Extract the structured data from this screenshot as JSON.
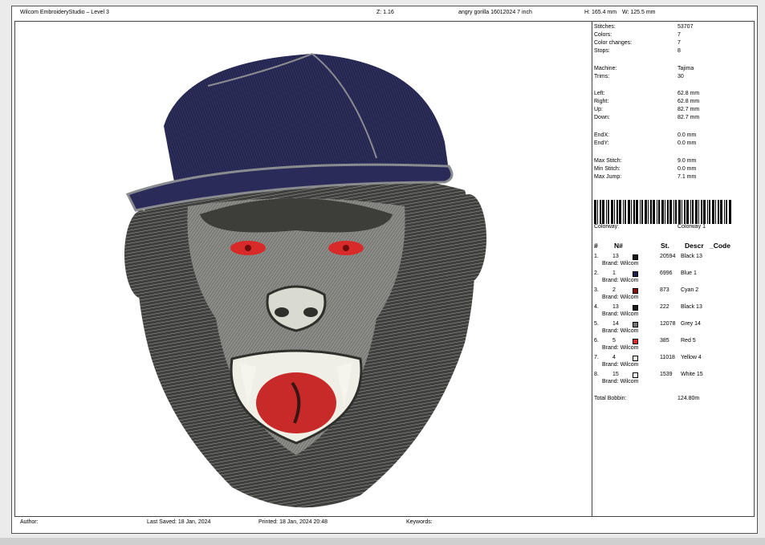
{
  "header": {
    "app_title": "Wilcom EmbroideryStudio – Level 3",
    "zoom": "Z: 1.16",
    "design_name": "angry gorilla 16012024 7 inch",
    "height": "H: 165.4 mm",
    "width": "W: 125.5 mm"
  },
  "stats": [
    {
      "label": "Stitches:",
      "value": "53707"
    },
    {
      "label": "Colors:",
      "value": "7"
    },
    {
      "label": "Color changes:",
      "value": "7"
    },
    {
      "label": "Stops:",
      "value": "8"
    },
    {
      "label": "Machine:",
      "value": "Tajima"
    },
    {
      "label": "Trims:",
      "value": "30"
    },
    {
      "label": "Left:",
      "value": "62.8 mm"
    },
    {
      "label": "Right:",
      "value": "62.8 mm"
    },
    {
      "label": "Up:",
      "value": "82.7 mm"
    },
    {
      "label": "Down:",
      "value": "82.7 mm"
    },
    {
      "label": "EndX:",
      "value": "0.0 mm"
    },
    {
      "label": "EndY:",
      "value": "0.0 mm"
    },
    {
      "label": "Max Stitch:",
      "value": "9.0 mm"
    },
    {
      "label": "Min Stitch:",
      "value": "0.0 mm"
    },
    {
      "label": "Max Jump:",
      "value": "7.1 mm"
    }
  ],
  "colorway": {
    "label": "Colorway:",
    "value": "Colorway 1"
  },
  "table": {
    "headers": {
      "index": "#",
      "needle": "N#",
      "stitches": "St.",
      "desc": "Descr",
      "code": "_Code"
    },
    "rows": [
      {
        "idx": "1.",
        "n": "13",
        "color": "#1a1a1a",
        "st": "20594",
        "desc": "Black 13",
        "brand": "Brand: Wilcom"
      },
      {
        "idx": "2.",
        "n": "1",
        "color": "#1e1f4a",
        "st": "6996",
        "desc": "Blue 1",
        "brand": "Brand: Wilcom"
      },
      {
        "idx": "3.",
        "n": "2",
        "color": "#8a1010",
        "st": "873",
        "desc": "Cyan 2",
        "brand": "Brand: Wilcom"
      },
      {
        "idx": "4.",
        "n": "13",
        "color": "#1a1a1a",
        "st": "222",
        "desc": "Black 13",
        "brand": "Brand: Wilcom"
      },
      {
        "idx": "5.",
        "n": "14",
        "color": "#777777",
        "st": "12078",
        "desc": "Grey 14",
        "brand": "Brand: Wilcom"
      },
      {
        "idx": "6.",
        "n": "5",
        "color": "#e02a2a",
        "st": "385",
        "desc": "Red 5",
        "brand": "Brand: Wilcom"
      },
      {
        "idx": "7.",
        "n": "4",
        "color": "#f2f2ea",
        "st": "11018",
        "desc": "Yellow 4",
        "brand": "Brand: Wilcom"
      },
      {
        "idx": "8.",
        "n": "15",
        "color": "#ffffff",
        "st": "1539",
        "desc": "White 15",
        "brand": "Brand: Wilcom"
      }
    ],
    "total_label": "Total Bobbin:",
    "total_value": "124.80m"
  },
  "footer": {
    "author": "Author:",
    "last_saved": "Last Saved: 18 Jan, 2024",
    "printed": "Printed: 18 Jan, 2024 20:48",
    "keywords": "Keywords:"
  }
}
